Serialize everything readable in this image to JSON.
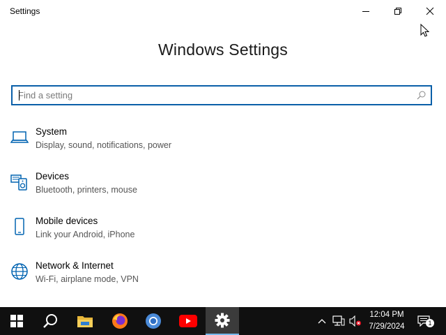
{
  "window": {
    "title": "Settings",
    "heading": "Windows Settings",
    "controls": [
      "minimize-icon",
      "restore-icon",
      "close-icon"
    ]
  },
  "search": {
    "placeholder": "Find a setting",
    "value": ""
  },
  "categories": [
    {
      "name": "System",
      "description": "Display, sound, notifications, power",
      "icon": "laptop-icon"
    },
    {
      "name": "Devices",
      "description": "Bluetooth, printers, mouse",
      "icon": "devices-icon"
    },
    {
      "name": "Mobile devices",
      "description": "Link your Android, iPhone",
      "icon": "phone-icon"
    },
    {
      "name": "Network & Internet",
      "description": "Wi-Fi, airplane mode, VPN",
      "icon": "globe-icon"
    }
  ],
  "taskbar": {
    "apps": [
      "start-icon",
      "search-icon",
      "file-explorer-icon",
      "firefox-icon",
      "chrome-icon",
      "youtube-icon",
      "settings-gear-icon"
    ],
    "active_app": "settings-gear-icon",
    "clock_time": "12:04 PM",
    "clock_date": "7/29/2024",
    "notification_count": "1"
  },
  "colors": {
    "accent": "#0a5fa8",
    "icon_blue": "#0063b1",
    "taskbar_bg": "#101010"
  }
}
